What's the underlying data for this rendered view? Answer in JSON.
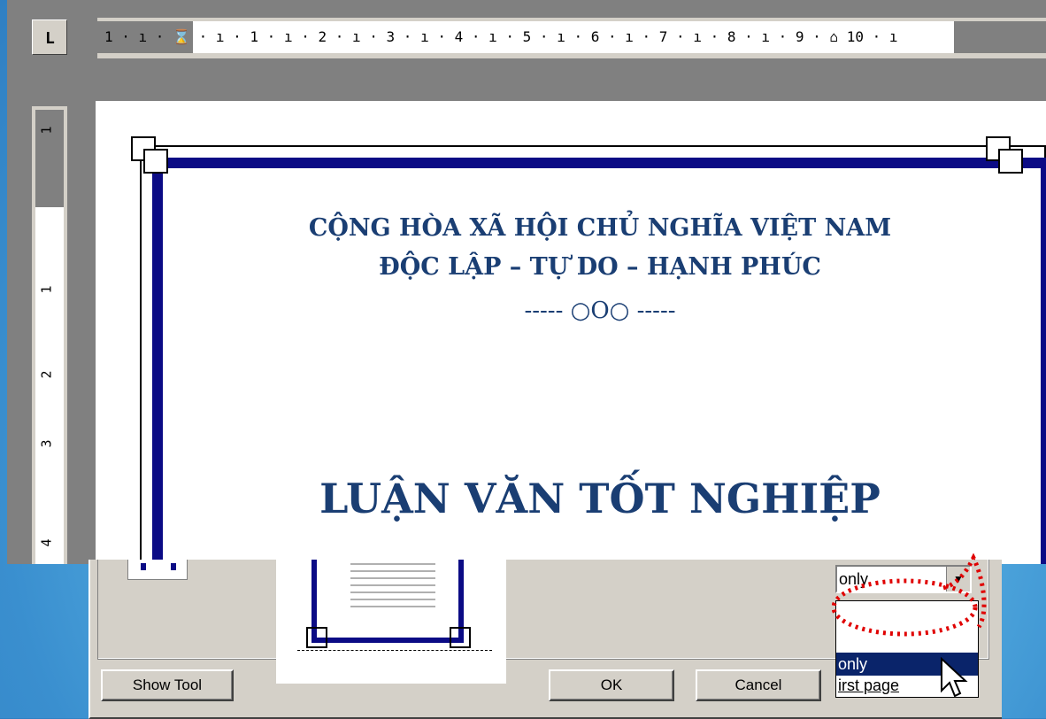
{
  "ruler": {
    "tab_marker": "L",
    "h_numbers": "1 · ı · ⌛ · ı · 1 · ı · 2 · ı · 3 · ı · 4 · ı · 5 · ı · 6 · ı · 7 · ı · 8 · ı · 9 · ⌂ 10 · ı",
    "v_numbers": [
      "1",
      "1",
      "2",
      "3",
      "4"
    ]
  },
  "document": {
    "line1": "CỘNG HÒA XÃ HỘI CHỦ NGHĨA VIỆT NAM",
    "line2": "ĐỘC LẬP – TỰ DO – HẠNH PHÚC",
    "ornament": "----- ○O○ -----",
    "title": "LUẬN VĂN TỐT NGHIỆP"
  },
  "dialog": {
    "show_toolbar_label": "Show Tool",
    "ok_label": "OK",
    "cancel_label": "Cancel",
    "apply_to_value": "only",
    "apply_to_options": [
      "only",
      "irst page"
    ]
  },
  "colors": {
    "border_blue": "#0b0b85",
    "heading_blue": "#1a3e73",
    "highlight_red": "#e00000",
    "selection": "#0a246a"
  }
}
